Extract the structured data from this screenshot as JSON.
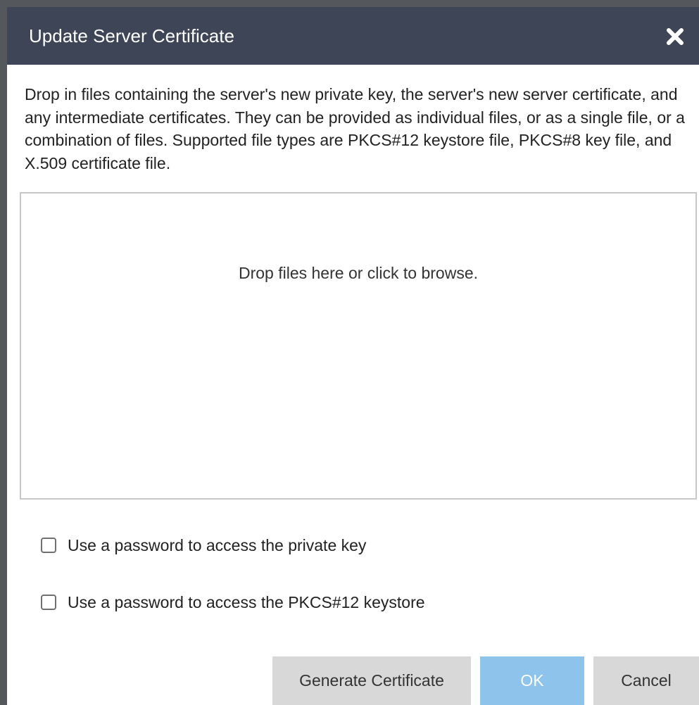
{
  "dialog": {
    "title": "Update Server Certificate",
    "close_icon": "close-x-icon",
    "description": "Drop in files containing the server's new private key, the server's new server certificate, and any intermediate certificates. They can be provided as individual files, or as a single file, or a combination of files. Supported file types are PKCS#12 keystore file, PKCS#8 key file, and X.509 certificate file.",
    "dropzone_text": "Drop files here or click to browse.",
    "options": {
      "private_key_password": {
        "label": "Use a password to access the private key",
        "checked": false
      },
      "keystore_password": {
        "label": "Use a password to access the PKCS#12 keystore",
        "checked": false
      }
    },
    "buttons": {
      "generate": "Generate Certificate",
      "ok": "OK",
      "cancel": "Cancel"
    }
  },
  "colors": {
    "titlebar": "#3e4556",
    "frame": "#54575c",
    "ok_button": "#8ec3ec",
    "secondary_button": "#d8d8d8",
    "dropzone_border": "#c7c7c7"
  }
}
